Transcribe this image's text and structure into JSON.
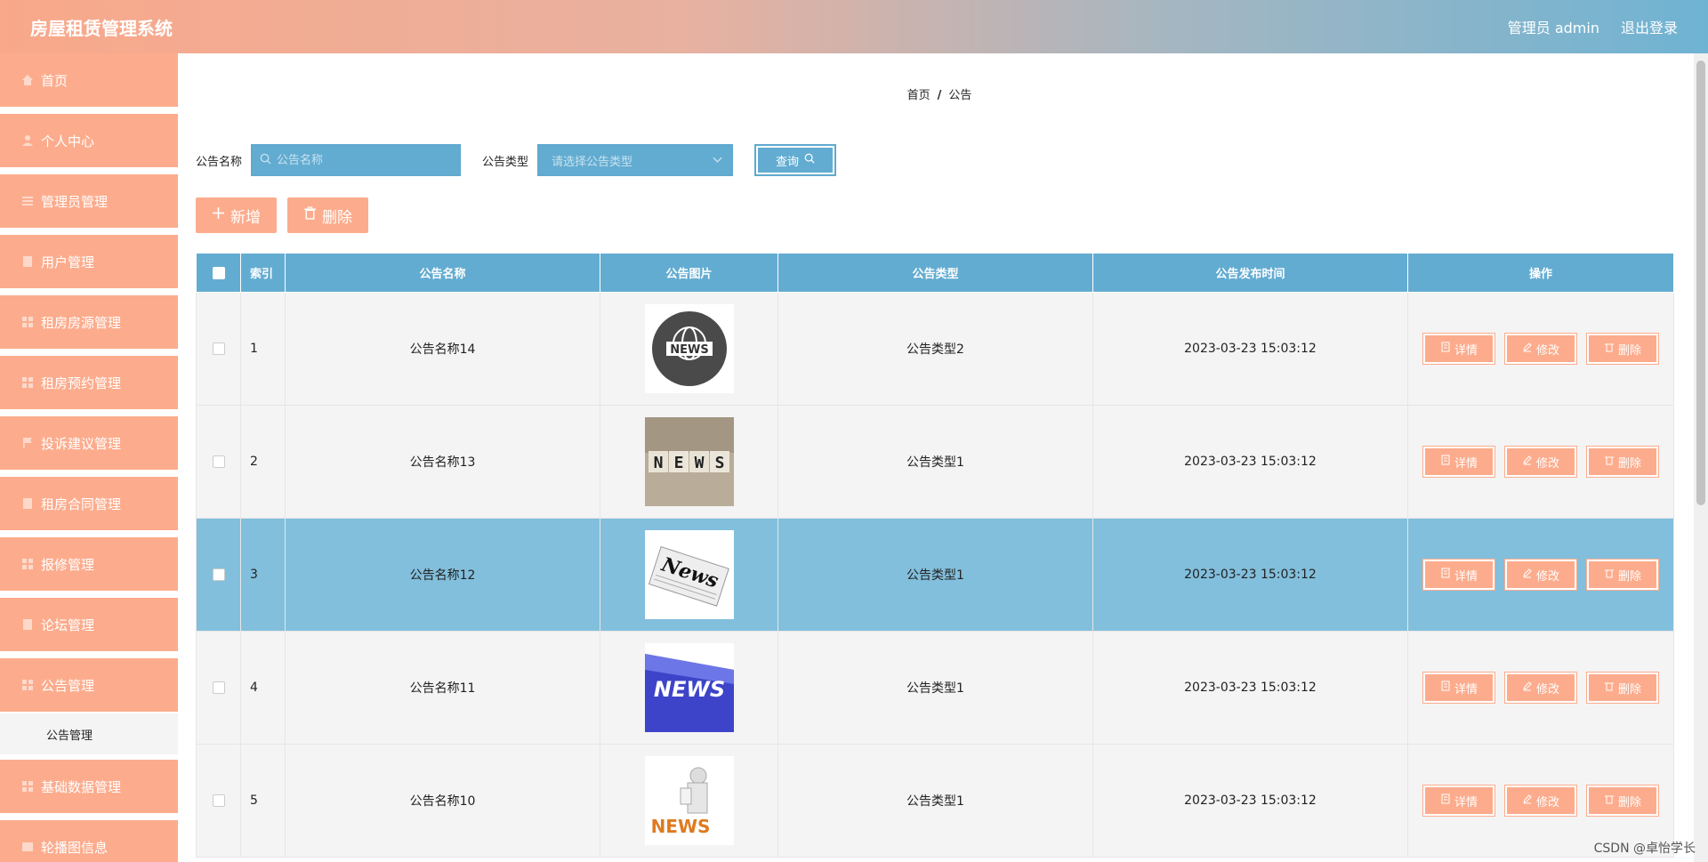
{
  "header": {
    "title": "房屋租赁管理系统",
    "user_label": "管理员 admin",
    "logout_label": "退出登录"
  },
  "sidebar": {
    "items": [
      {
        "label": "首页",
        "icon": "home-icon"
      },
      {
        "label": "个人中心",
        "icon": "user-icon"
      },
      {
        "label": "管理员管理",
        "icon": "list-icon"
      },
      {
        "label": "用户管理",
        "icon": "folder-icon"
      },
      {
        "label": "租房房源管理",
        "icon": "grid-icon"
      },
      {
        "label": "租房预约管理",
        "icon": "grid-icon"
      },
      {
        "label": "投诉建议管理",
        "icon": "flag-icon"
      },
      {
        "label": "租房合同管理",
        "icon": "folder-icon"
      },
      {
        "label": "报修管理",
        "icon": "grid-icon"
      },
      {
        "label": "论坛管理",
        "icon": "folder-icon"
      },
      {
        "label": "公告管理",
        "icon": "grid-icon"
      },
      {
        "label": "基础数据管理",
        "icon": "grid-icon"
      },
      {
        "label": "轮播图信息",
        "icon": "image-icon"
      }
    ],
    "submenu_label": "公告管理"
  },
  "breadcrumb": {
    "home": "首页",
    "sep": "/",
    "current": "公告"
  },
  "search": {
    "name_label": "公告名称",
    "name_placeholder": "公告名称",
    "type_label": "公告类型",
    "type_placeholder": "请选择公告类型",
    "query_label": "查询"
  },
  "actions": {
    "add_label": "新增",
    "delete_label": "删除"
  },
  "table": {
    "headers": [
      "索引",
      "公告名称",
      "公告图片",
      "公告类型",
      "公告发布时间",
      "操作"
    ],
    "rows": [
      {
        "index": "1",
        "name": "公告名称14",
        "type": "公告类型2",
        "time": "2023-03-23 15:03:12",
        "image": "news-globe-icon"
      },
      {
        "index": "2",
        "name": "公告名称13",
        "type": "公告类型1",
        "time": "2023-03-23 15:03:12",
        "image": "news-dice-image"
      },
      {
        "index": "3",
        "name": "公告名称12",
        "type": "公告类型1",
        "time": "2023-03-23 15:03:12",
        "image": "news-paper-image"
      },
      {
        "index": "4",
        "name": "公告名称11",
        "type": "公告类型1",
        "time": "2023-03-23 15:03:12",
        "image": "news-key-image"
      },
      {
        "index": "5",
        "name": "公告名称10",
        "type": "公告类型1",
        "time": "2023-03-23 15:03:12",
        "image": "news-figure-image"
      }
    ],
    "op_labels": {
      "detail": "详情",
      "edit": "修改",
      "delete": "删除"
    }
  },
  "colors": {
    "accent": "#fcac8d",
    "header_blue": "#63acd1",
    "selected_row": "#82bfdc"
  },
  "watermark": "CSDN @卓怡学长"
}
